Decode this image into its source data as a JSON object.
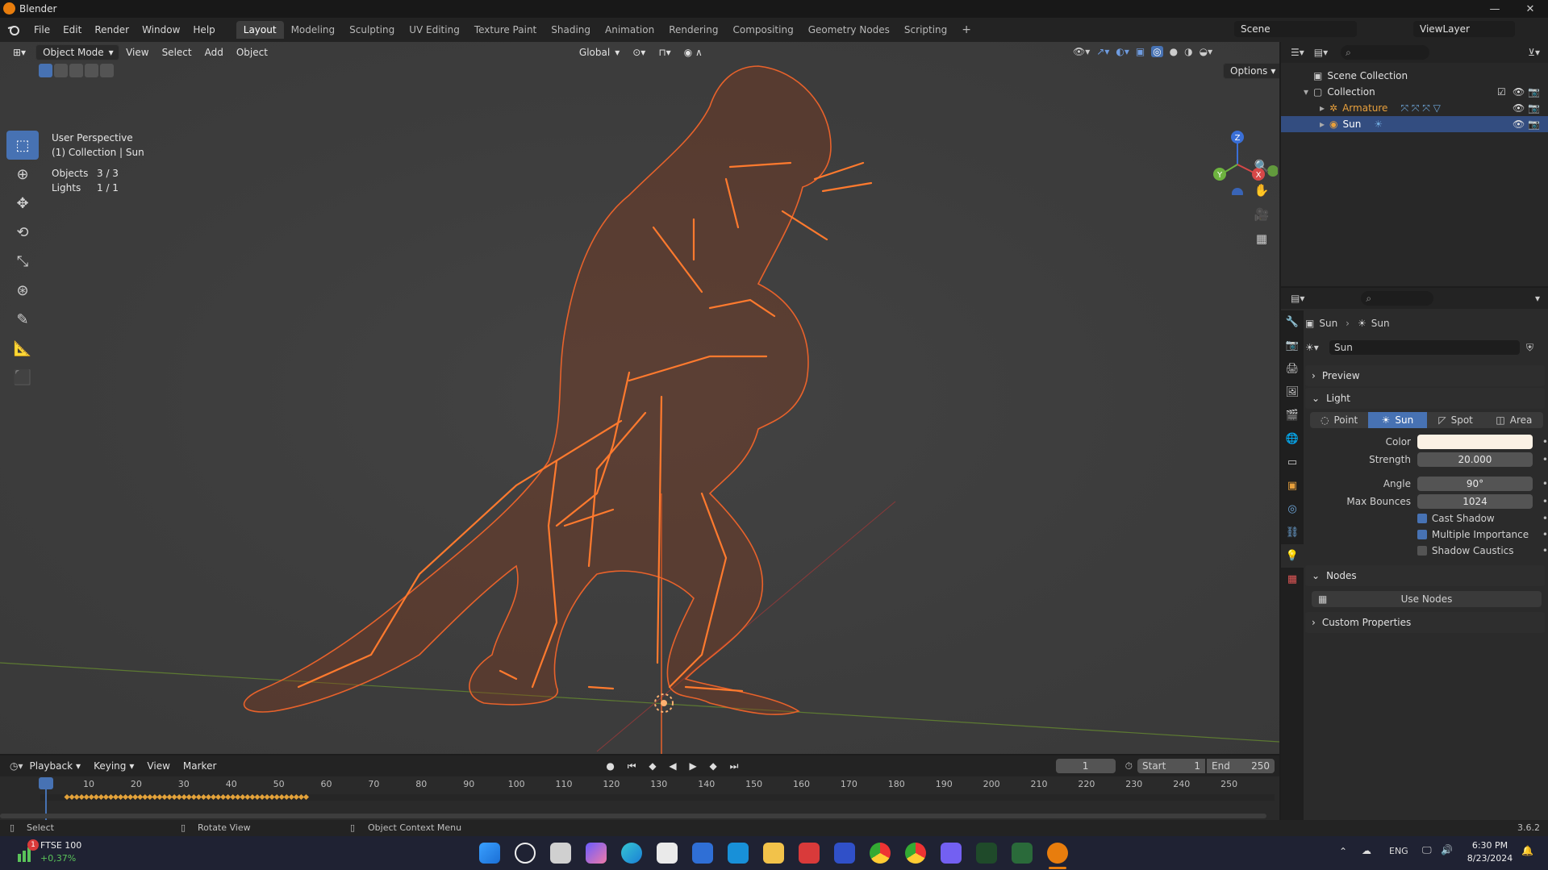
{
  "app": {
    "title": "Blender",
    "version": "3.6.2"
  },
  "menus": [
    "File",
    "Edit",
    "Render",
    "Window",
    "Help"
  ],
  "workspaces": [
    "Layout",
    "Modeling",
    "Sculpting",
    "UV Editing",
    "Texture Paint",
    "Shading",
    "Animation",
    "Rendering",
    "Compositing",
    "Geometry Nodes",
    "Scripting"
  ],
  "topbar": {
    "scene": "Scene",
    "view_layer": "ViewLayer"
  },
  "viewport": {
    "mode": "Object Mode",
    "menus": [
      "View",
      "Select",
      "Add",
      "Object"
    ],
    "transform_orientation": "Global",
    "options_label": "Options",
    "perspective": "User Perspective",
    "context": "(1) Collection | Sun",
    "stats": [
      {
        "label": "Objects",
        "value": "3 / 3"
      },
      {
        "label": "Lights",
        "value": "1 / 1"
      }
    ],
    "gizmo_axes": [
      "Z",
      "Y",
      "X"
    ]
  },
  "outliner": {
    "root": "Scene Collection",
    "collection": "Collection",
    "items": [
      {
        "name": "Armature",
        "selected": false
      },
      {
        "name": "Sun",
        "selected": true
      }
    ]
  },
  "properties": {
    "breadcrumb": [
      "Sun",
      "Sun"
    ],
    "datablock": "Sun",
    "panels": {
      "preview": "Preview",
      "light": "Light",
      "nodes": "Nodes",
      "custom": "Custom Properties"
    },
    "light_types": [
      "Point",
      "Sun",
      "Spot",
      "Area"
    ],
    "active_light_type": "Sun",
    "color_label": "Color",
    "color_value": "#fbf1e4",
    "strength_label": "Strength",
    "strength": "20.000",
    "angle_label": "Angle",
    "angle": "90°",
    "bounces_label": "Max Bounces",
    "bounces": "1024",
    "checks": [
      {
        "label": "Cast Shadow",
        "on": true
      },
      {
        "label": "Multiple Importance",
        "on": true
      },
      {
        "label": "Shadow Caustics",
        "on": false
      }
    ],
    "use_nodes": "Use Nodes"
  },
  "timeline": {
    "menus": [
      "Playback",
      "Keying",
      "View",
      "Marker"
    ],
    "current_frame": "1",
    "start_label": "Start",
    "start": "1",
    "end_label": "End",
    "end": "250",
    "ruler": [
      "1",
      "10",
      "20",
      "30",
      "40",
      "50",
      "60",
      "70",
      "80",
      "90",
      "100",
      "110",
      "120",
      "130",
      "140",
      "150",
      "160",
      "170",
      "180",
      "190",
      "200",
      "210",
      "220",
      "230",
      "240",
      "250"
    ]
  },
  "statusbar": {
    "hints": [
      "Select",
      "Rotate View",
      "Object Context Menu"
    ],
    "version": "3.6.2"
  },
  "taskbar": {
    "stock_name": "FTSE 100",
    "stock_change": "+0,37%",
    "stock_badge": "1",
    "lang": "ENG",
    "time": "6:30 PM",
    "date": "8/23/2024"
  },
  "colors": {
    "accent": "#4772b3",
    "wireframe": "#e8622b",
    "blender_orange": "#e87d0d"
  }
}
